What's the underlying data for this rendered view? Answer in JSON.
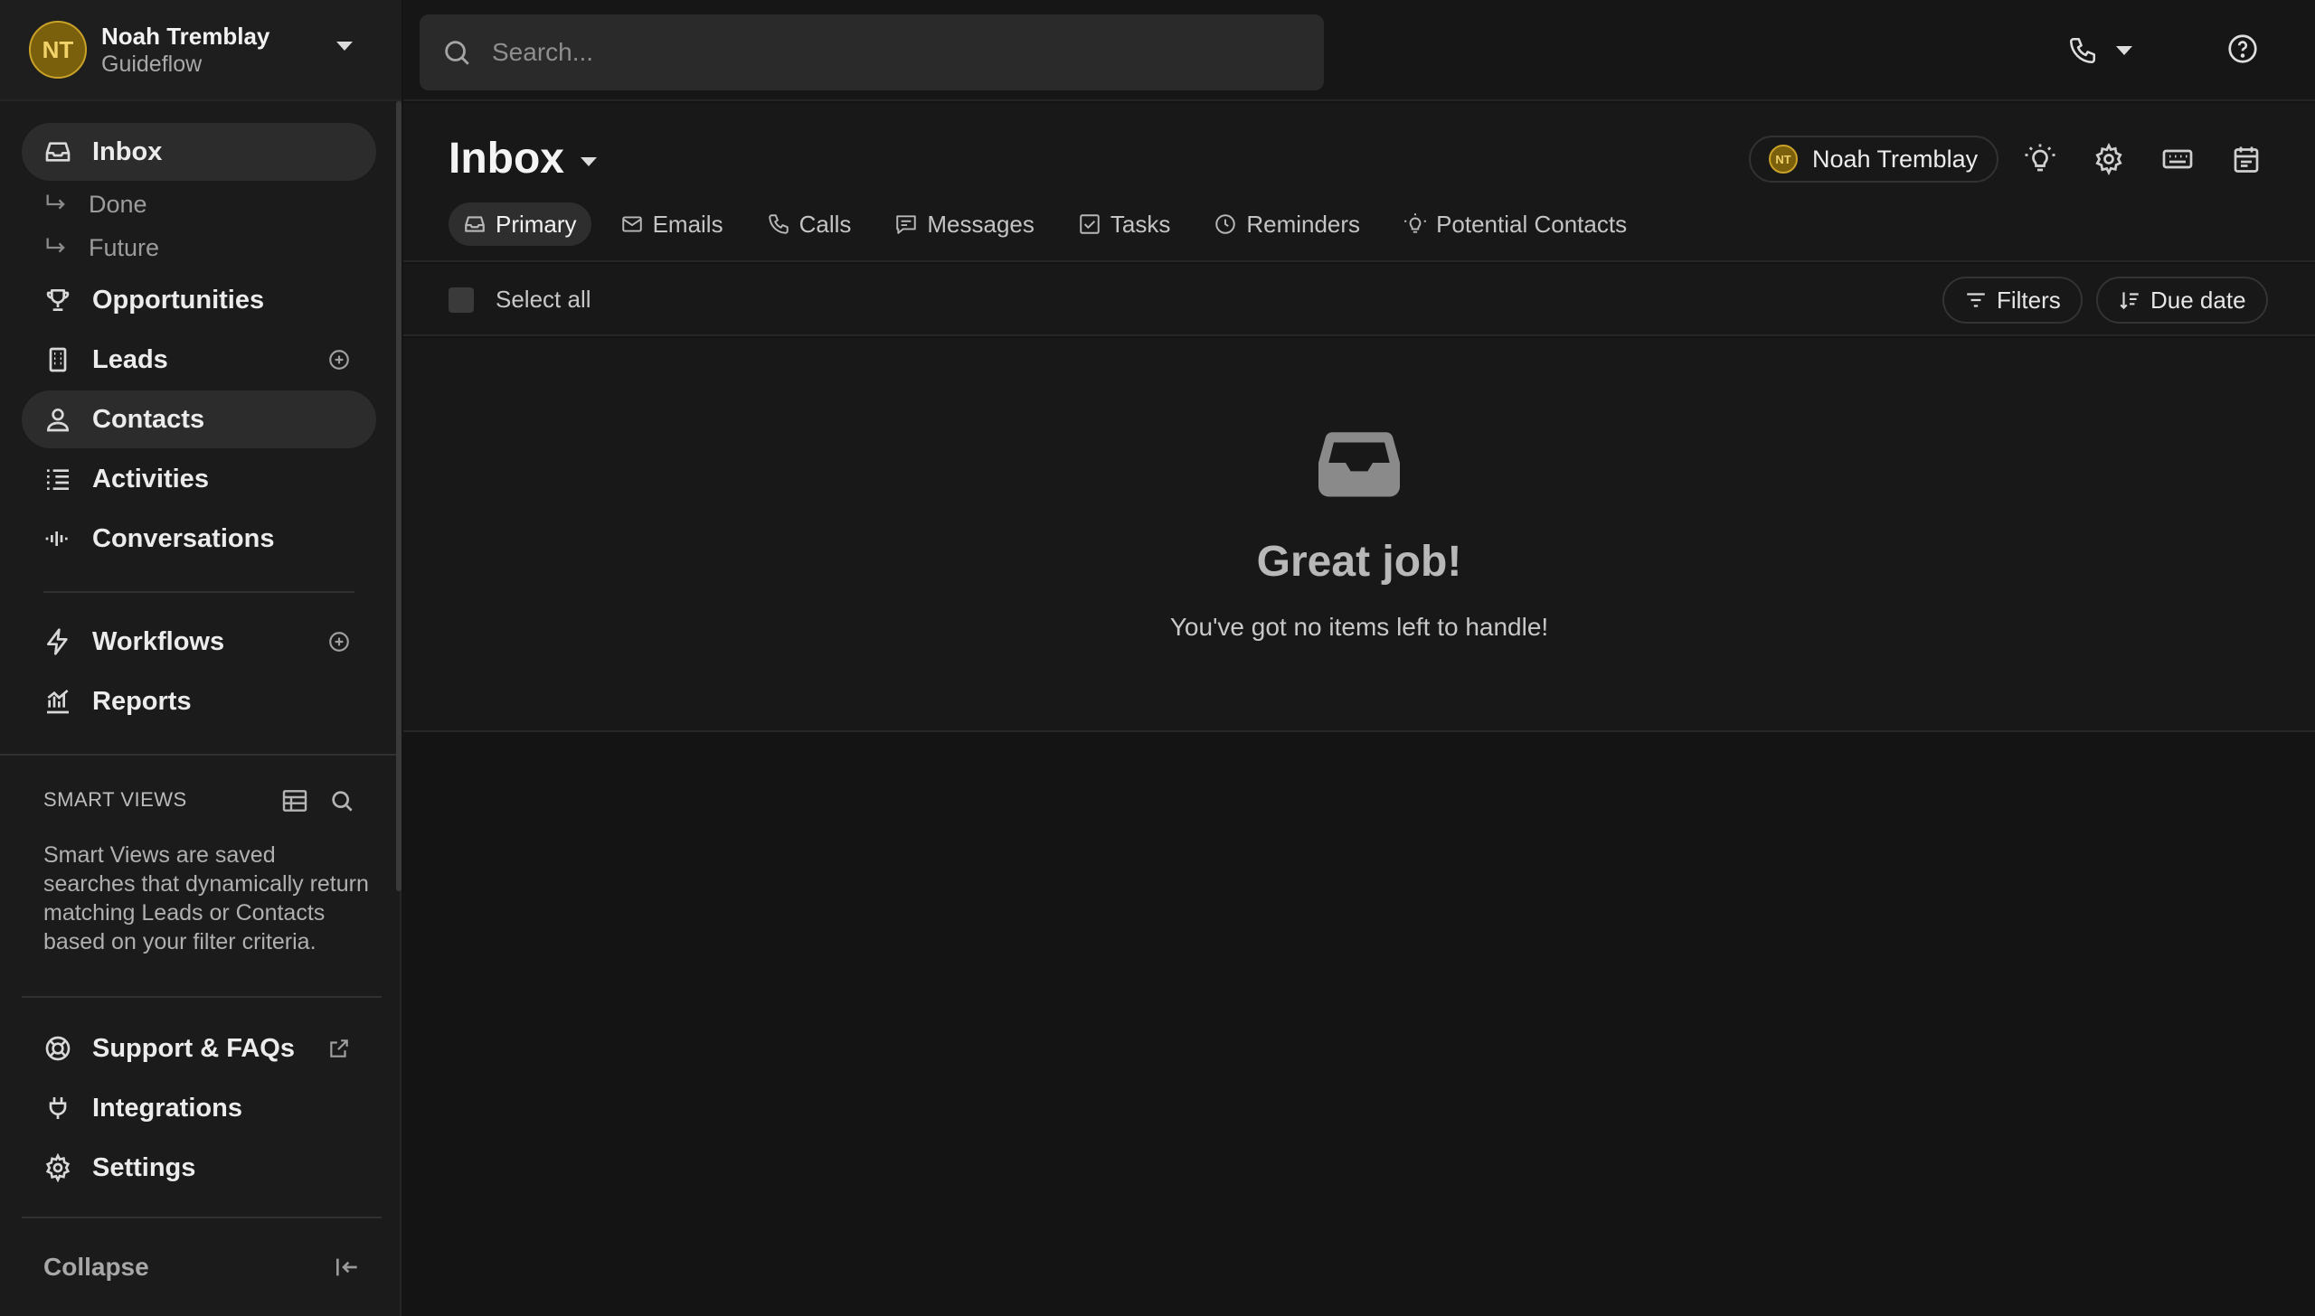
{
  "account": {
    "initials": "NT",
    "name": "Noah Tremblay",
    "org": "Guideflow"
  },
  "search": {
    "placeholder": "Search..."
  },
  "sidebar": {
    "inbox": "Inbox",
    "done": "Done",
    "future": "Future",
    "opportunities": "Opportunities",
    "leads": "Leads",
    "contacts": "Contacts",
    "activities": "Activities",
    "conversations": "Conversations",
    "workflows": "Workflows",
    "reports": "Reports",
    "smart_views_heading": "SMART VIEWS",
    "smart_views_desc": "Smart Views are saved searches that dynamically return matching Leads or Contacts based on your filter criteria.",
    "support": "Support & FAQs",
    "integrations": "Integrations",
    "settings": "Settings",
    "collapse": "Collapse"
  },
  "main": {
    "title": "Inbox",
    "user_filter": {
      "initials": "NT",
      "name": "Noah Tremblay"
    },
    "tabs": [
      {
        "label": "Primary",
        "icon": "inbox-icon"
      },
      {
        "label": "Emails",
        "icon": "mail-icon"
      },
      {
        "label": "Calls",
        "icon": "phone-icon"
      },
      {
        "label": "Messages",
        "icon": "message-icon"
      },
      {
        "label": "Tasks",
        "icon": "checkbox-icon"
      },
      {
        "label": "Reminders",
        "icon": "clock-icon"
      },
      {
        "label": "Potential Contacts",
        "icon": "lightbulb-icon"
      }
    ],
    "select_all": "Select all",
    "filters": "Filters",
    "sort": "Due date",
    "empty_title": "Great job!",
    "empty_subtitle": "You've got no items left to handle!"
  },
  "colors": {
    "avatar_bg": "#7a5f0c",
    "avatar_border": "#c9a227",
    "background": "#141414",
    "sidebar_bg": "#1b1b1b"
  }
}
